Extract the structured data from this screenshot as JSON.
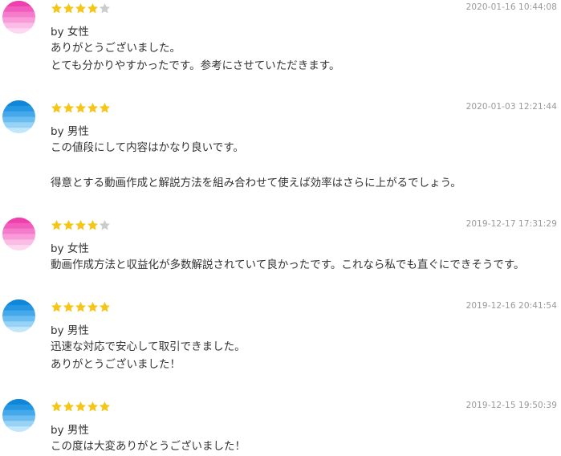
{
  "reviews": [
    {
      "gender": "female",
      "rating": 4,
      "date": "2020-01-16 10:44:08",
      "by": "by 女性",
      "lines": [
        "ありがとうございました。",
        "とても分かりやすかったです。参考にさせていただきます。"
      ]
    },
    {
      "gender": "male",
      "rating": 5,
      "date": "2020-01-03 12:21:44",
      "by": "by 男性",
      "lines": [
        "この値段にして内容はかなり良いです。",
        "",
        "得意とする動画作成と解説方法を組み合わせて使えば効率はさらに上がるでしょう。"
      ]
    },
    {
      "gender": "female",
      "rating": 4,
      "date": "2019-12-17 17:31:29",
      "by": "by 女性",
      "lines": [
        "動画作成方法と収益化が多数解説されていて良かったです。これなら私でも直ぐにできそうです。"
      ]
    },
    {
      "gender": "male",
      "rating": 5,
      "date": "2019-12-16 20:41:54",
      "by": "by 男性",
      "lines": [
        "迅速な対応で安心して取引できました。",
        "ありがとうございました！"
      ]
    },
    {
      "gender": "male",
      "rating": 5,
      "date": "2019-12-15 19:50:39",
      "by": "by 男性",
      "lines": [
        "この度は大変ありがとうございました！"
      ]
    }
  ],
  "max_rating": 5,
  "colors": {
    "star_filled": "#f5c518",
    "star_empty": "#cccccc",
    "female_avatar": [
      "#ee3fae",
      "#f25cbc",
      "#f57ccb",
      "#f89bd8",
      "#fbbce6",
      "#fdd8f0"
    ],
    "male_avatar": [
      "#0f86d8",
      "#2596e2",
      "#44a8ea",
      "#6bbdf1",
      "#96d3f6",
      "#c2e6fa"
    ],
    "date_text": "#999999",
    "body_text": "#333333"
  }
}
